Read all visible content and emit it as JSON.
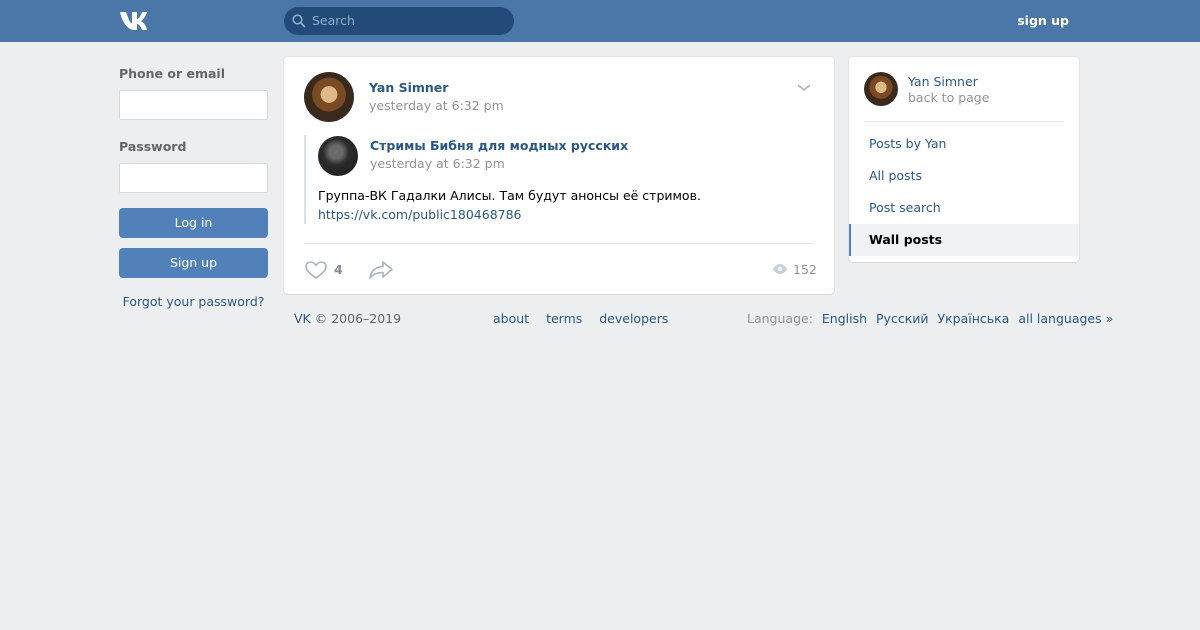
{
  "header": {
    "logo": "vk-logo",
    "search_placeholder": "Search",
    "signup_label": "sign up"
  },
  "login": {
    "phone_label": "Phone or email",
    "password_label": "Password",
    "login_button": "Log in",
    "signup_button": "Sign up",
    "forgot_link": "Forgot your password?"
  },
  "post": {
    "author": "Yan Simner",
    "time": "yesterday at 6:32 pm",
    "repost": {
      "group_name": "Стримы Бибня для модных русских",
      "time": "yesterday at 6:32 pm",
      "text": "Группа-ВК Гадалки Алисы. Там будут анонсы её стримов.",
      "link": "https://vk.com/public180468786"
    },
    "likes": "4",
    "views": "152"
  },
  "footer": {
    "brand": "VK",
    "copyright": "© 2006–2019",
    "links": [
      "about",
      "terms",
      "developers"
    ],
    "language_label": "Language:",
    "languages": [
      "English",
      "Русский",
      "Українська",
      "all languages »"
    ]
  },
  "sidebar": {
    "name": "Yan Simner",
    "back": "back to page",
    "items": [
      {
        "label": "Posts by Yan",
        "active": false
      },
      {
        "label": "All posts",
        "active": false
      },
      {
        "label": "Post search",
        "active": false
      },
      {
        "label": "Wall posts",
        "active": true
      }
    ]
  },
  "colors": {
    "header": "#4a76a8",
    "accent": "#5181b8",
    "link": "#2a5885",
    "background": "#edeef0"
  }
}
